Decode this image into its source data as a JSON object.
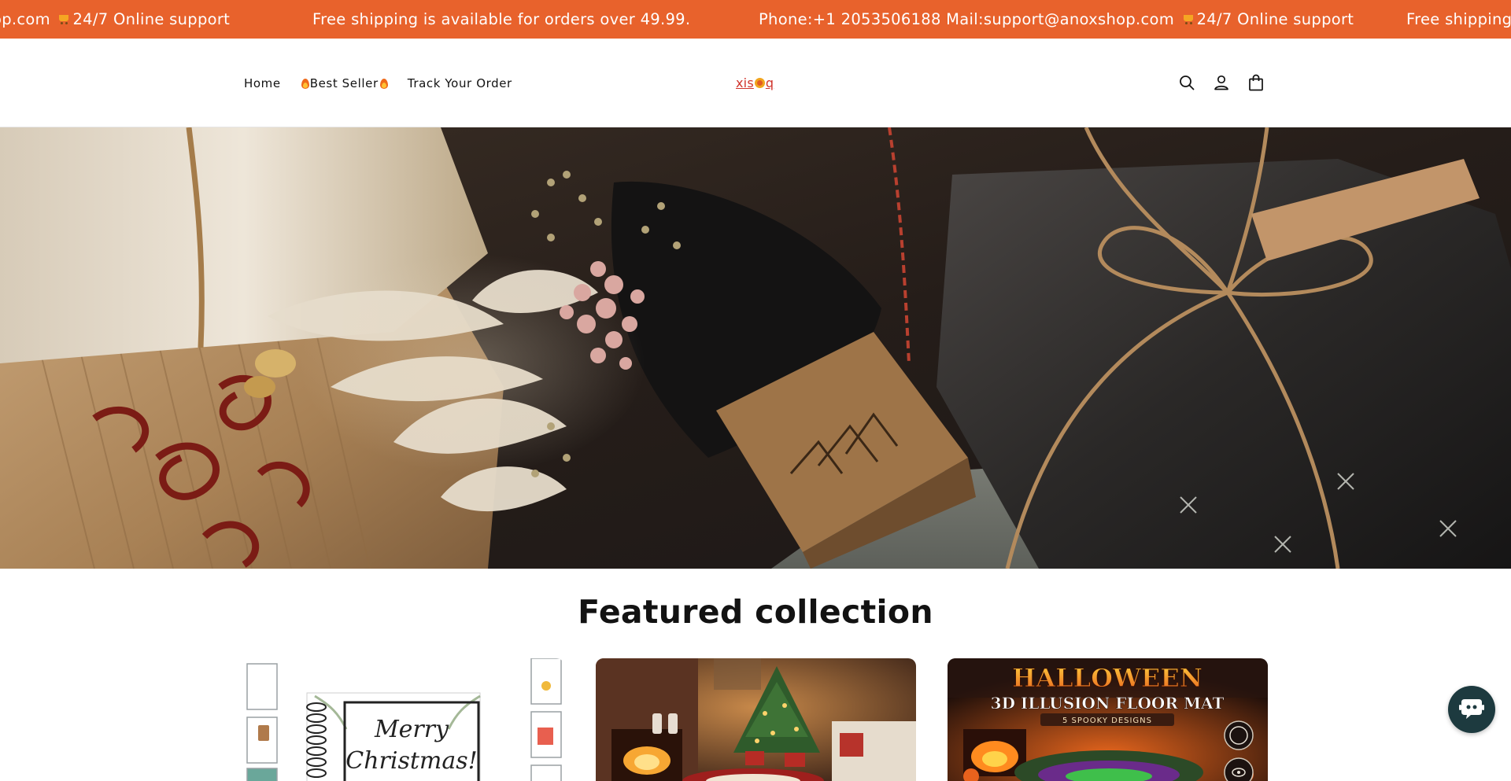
{
  "announcement": {
    "msg1_text": "op.com",
    "msg1_suffix": "24/7 Online support",
    "msg2": "Free shipping is available for orders over 49.99.",
    "msg3_text": "Phone:+1 2053506188 Mail:support@anoxshop.com",
    "msg3_suffix": "24/7 Online support",
    "msg4": "Free shipping",
    "background_color": "#e8622c"
  },
  "nav": {
    "home": "Home",
    "best_seller": "Best Seller",
    "track_order": "Track Your Order"
  },
  "logo": {
    "left": "xis",
    "right": "q"
  },
  "header_icons": [
    "search-icon",
    "account-icon",
    "cart-icon"
  ],
  "featured": {
    "title": "Featured collection",
    "cards": [
      {
        "image_text": [
          "Merry",
          "Christmas!"
        ]
      },
      {
        "image_text": []
      },
      {
        "image_text": [
          "HALLOWEEN",
          "3D ILLUSION FLOOR MAT",
          "5 SPOOKY DESIGNS"
        ]
      }
    ]
  },
  "chat": {
    "icon": "chat-bot-icon",
    "color": "#1d3a3f"
  }
}
